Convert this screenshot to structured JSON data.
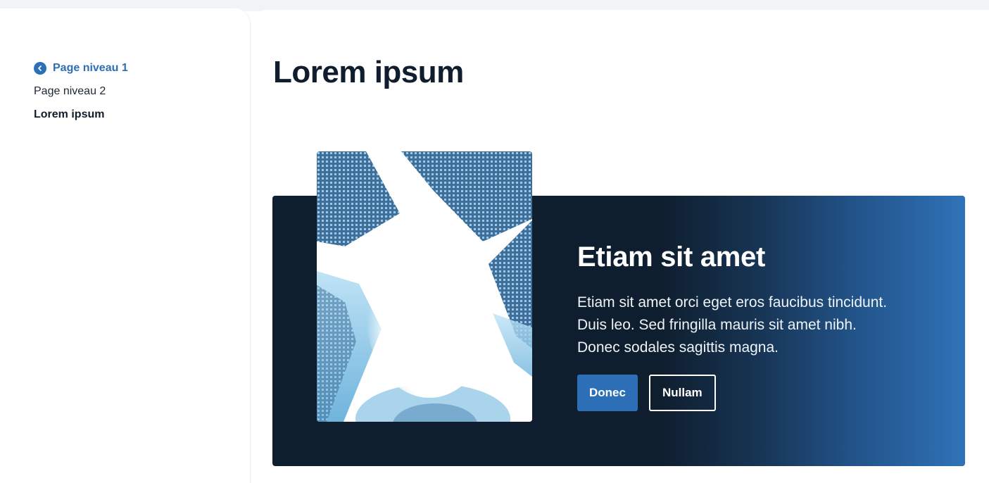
{
  "breadcrumb": {
    "items": [
      {
        "label": "Page niveau 1"
      },
      {
        "label": "Page niveau 2"
      },
      {
        "label": "Lorem ipsum"
      }
    ]
  },
  "main": {
    "title": "Lorem ipsum"
  },
  "hero": {
    "title": "Etiam sit amet",
    "text": "Etiam sit amet orci eget eros faucibus tincidunt. Duis leo. Sed fringilla mauris sit amet nibh. Donec sodales sagittis magna.",
    "primary_button": "Donec",
    "secondary_button": "Nullam"
  },
  "icons": {
    "back": "chevron-left-icon"
  },
  "colors": {
    "accent": "#2d6fb6",
    "hero_dark": "#0f1e2e",
    "hero_light": "#2f73b8",
    "text_dark": "#0f1d2c"
  }
}
